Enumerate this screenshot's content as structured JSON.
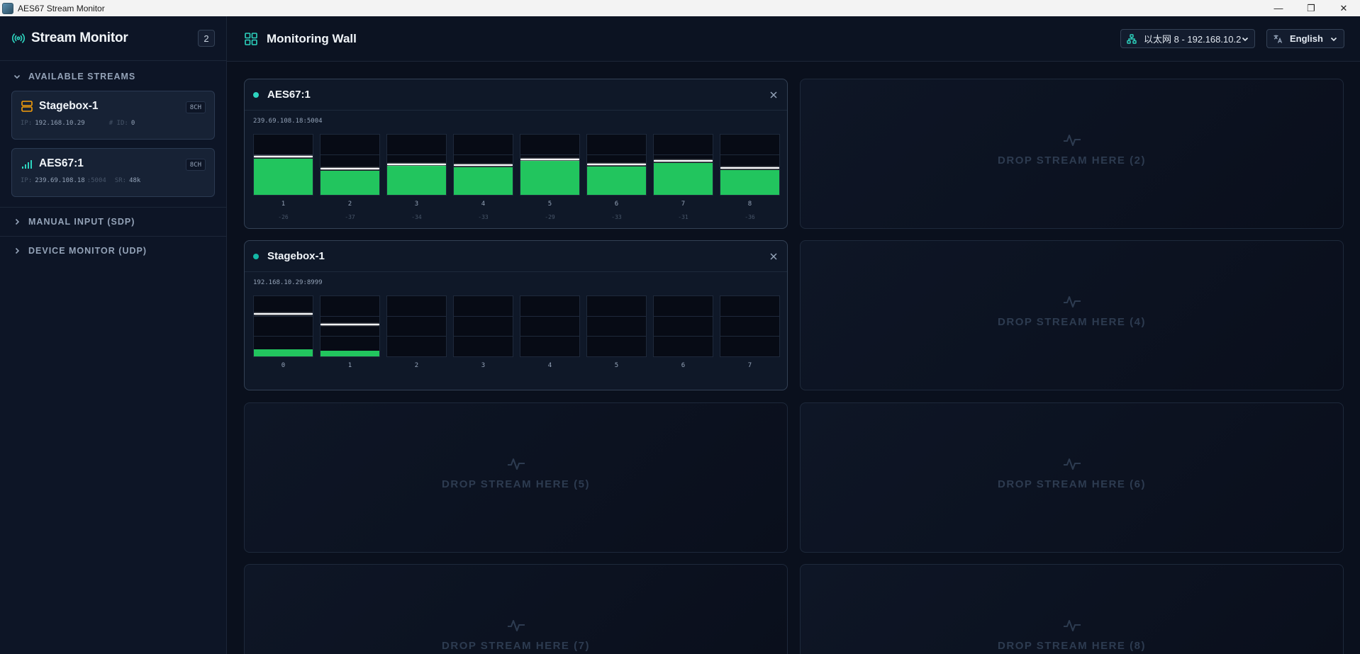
{
  "window": {
    "title": "AES67 Stream Monitor",
    "minimize": "—",
    "restore": "❐",
    "close": "✕"
  },
  "sidebar": {
    "title": "Stream Monitor",
    "count": "2",
    "sections": {
      "available": "AVAILABLE STREAMS",
      "manual": "MANUAL INPUT (SDP)",
      "device": "DEVICE MONITOR (UDP)"
    },
    "streams": [
      {
        "name": "Stagebox-1",
        "channels": "8CH",
        "icon": "server-icon",
        "ip_key": "IP:",
        "ip": "192.168.10.29",
        "extra_key": "# ID:",
        "extra": "0"
      },
      {
        "name": "AES67:1",
        "channels": "8CH",
        "icon": "signal-icon",
        "ip_key": "IP:",
        "ip": "239.69.108.18",
        "port": ":5004",
        "extra_key": "SR:",
        "extra": "48k"
      }
    ]
  },
  "main": {
    "title": "Monitoring Wall",
    "network_select": "以太网 8 - 192.168.10.2",
    "language_select": "English",
    "drop_slots": [
      "DROP STREAM HERE (2)",
      "DROP STREAM HERE (4)",
      "DROP STREAM HERE (5)",
      "DROP STREAM HERE (6)",
      "DROP STREAM HERE (7)",
      "DROP STREAM HERE (8)"
    ],
    "monitors": [
      {
        "name": "AES67:1",
        "address": "239.69.108.18:5004",
        "status_color": "#2dd4bf",
        "channels": [
          {
            "label": "1",
            "db": "-26",
            "level": 0.6,
            "peak": 0.62
          },
          {
            "label": "2",
            "db": "-37",
            "level": 0.4,
            "peak": 0.42
          },
          {
            "label": "3",
            "db": "-34",
            "level": 0.48,
            "peak": 0.5
          },
          {
            "label": "4",
            "db": "-33",
            "level": 0.46,
            "peak": 0.48
          },
          {
            "label": "5",
            "db": "-29",
            "level": 0.56,
            "peak": 0.58
          },
          {
            "label": "6",
            "db": "-33",
            "level": 0.47,
            "peak": 0.49
          },
          {
            "label": "7",
            "db": "-31",
            "level": 0.53,
            "peak": 0.55
          },
          {
            "label": "8",
            "db": "-36",
            "level": 0.41,
            "peak": 0.43
          }
        ]
      },
      {
        "name": "Stagebox-1",
        "address": "192.168.10.29:8999",
        "status_color": "#2dd4bf",
        "channels": [
          {
            "label": "0",
            "db": "",
            "level": 0.12,
            "peak": 0.7
          },
          {
            "label": "1",
            "db": "",
            "level": 0.09,
            "peak": 0.52
          },
          {
            "label": "2",
            "db": "",
            "level": 0,
            "peak": null
          },
          {
            "label": "3",
            "db": "",
            "level": 0,
            "peak": null
          },
          {
            "label": "4",
            "db": "",
            "level": 0,
            "peak": null
          },
          {
            "label": "5",
            "db": "",
            "level": 0,
            "peak": null
          },
          {
            "label": "6",
            "db": "",
            "level": 0,
            "peak": null
          },
          {
            "label": "7",
            "db": "",
            "level": 0,
            "peak": null
          }
        ]
      }
    ]
  },
  "colors": {
    "accent": "#2dd4bf",
    "meter_fill": "#22c55e",
    "peak": "#f8fafc",
    "server_icon": "#f59e0b"
  }
}
